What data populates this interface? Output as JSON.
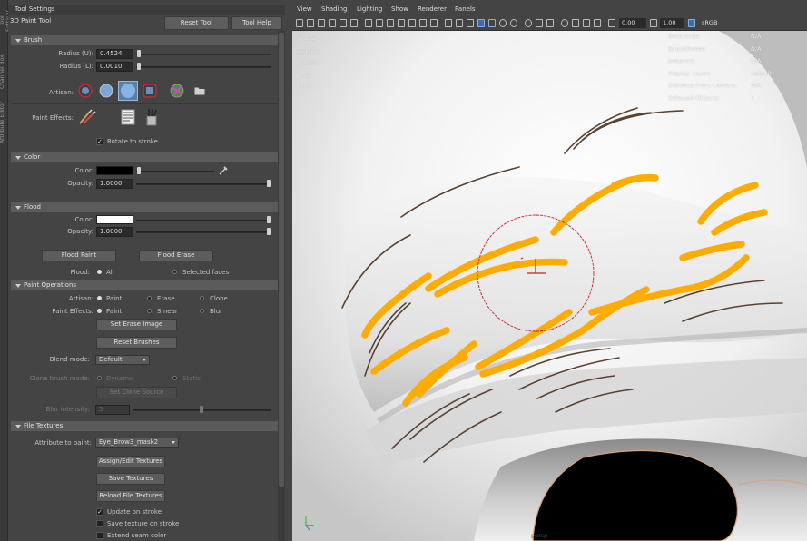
{
  "colors": {
    "panel_bg": "#444444",
    "section_bg": "#5b5b5b",
    "stroke_orange": "#ffac00",
    "brush_circle": "#cc1e28",
    "hair_brown": "#5a4232",
    "viewport_bg": "#e6e6e6"
  },
  "side_tabs": [
    "Tool Settings",
    "Channel Box",
    "Attribute Editor"
  ],
  "panel": {
    "tab_label": "Tool Settings",
    "tool_name": "3D Paint Tool",
    "reset_tool": "Reset Tool",
    "tool_help": "Tool Help"
  },
  "brush": {
    "title": "Brush",
    "radius_u_label": "Radius (U):",
    "radius_u_value": "0.4524",
    "radius_u_level": 0.01,
    "radius_l_label": "Radius (L):",
    "radius_l_value": "0.0010",
    "radius_l_level": 0.01,
    "artisan_label": "Artisan:",
    "artisan_icons": [
      "brush-soft-icon",
      "brush-solid-icon",
      "brush-solid-large-icon",
      "brush-square-icon",
      "brush-texture-icon",
      "folder-icon"
    ],
    "paint_effects_label": "Paint Effects:",
    "paint_effects_icons": [
      "paint-effects-brush-icon",
      "brush-settings-icon",
      "brushes-icon"
    ],
    "rotate_label": "Rotate to stroke",
    "rotate_checked": true
  },
  "color": {
    "title": "Color",
    "color_label": "Color:",
    "color_value": "#000000",
    "color_level": 0.01,
    "opacity_label": "Opacity:",
    "opacity_value": "1.0000",
    "opacity_level": 1.0
  },
  "flood": {
    "title": "Flood",
    "color_label": "Color:",
    "color_value": "#ffffff",
    "color_level": 1.0,
    "opacity_label": "Opacity:",
    "opacity_value": "1.0000",
    "opacity_level": 1.0,
    "flood_paint": "Flood Paint",
    "flood_erase": "Flood Erase",
    "flood_label": "Flood:",
    "option_all": "All",
    "option_selected": "Selected faces",
    "selected": "All"
  },
  "paint_operations": {
    "title": "Paint Operations",
    "artisan_label": "Artisan:",
    "artisan_options": [
      "Paint",
      "Erase",
      "Clone"
    ],
    "artisan_selected": "Paint",
    "effects_label": "Paint Effects:",
    "effects_options": [
      "Paint",
      "Smear",
      "Blur"
    ],
    "effects_selected": "Paint",
    "set_erase_image": "Set Erase Image",
    "reset_brushes": "Reset Brushes",
    "blend_label": "Blend mode:",
    "blend_value": "Default",
    "clone_label": "Clone brush mode:",
    "clone_options": [
      "Dynamic",
      "Static"
    ],
    "clone_selected": "Dynamic",
    "set_clone_source": "Set Clone Source",
    "blur_label": "Blur intensity:",
    "blur_value": "5",
    "blur_level": 0.5
  },
  "file_textures": {
    "title": "File Textures",
    "attribute_label": "Attribute to paint:",
    "attribute_value": "Eye_Brow3_mask2",
    "assign_edit": "Assign/Edit Textures",
    "save_textures": "Save Textures",
    "reload": "Reload File Textures",
    "update_on_stroke": "Update on stroke",
    "update_checked": true,
    "save_on_stroke": "Save texture on stroke",
    "save_checked": false,
    "extend_seam": "Extend seam color",
    "extend_checked": false
  },
  "viewport": {
    "menus": [
      "View",
      "Shading",
      "Lighting",
      "Show",
      "Renderer",
      "Panels"
    ],
    "toolbar_value_1": "0.00",
    "toolbar_value_2": "1.00",
    "color_space": "sRGB gamma",
    "camera_label": "persp",
    "hud_left_labels": [
      "Verts:",
      "Edges:",
      "Faces:",
      "Tris:",
      "UVs:"
    ],
    "hud_left_col1": [
      "",
      "",
      "",
      "",
      ""
    ],
    "hud_left_col2": [
      "",
      "",
      "",
      "",
      ""
    ],
    "hud_left_col3": [
      "",
      "",
      "",
      "",
      ""
    ],
    "hud_right_labels": [
      "Backfaces:",
      "Smoothness:",
      "Instance:",
      "Display Layer:",
      "Distance From Camera:",
      "Selected Objects:"
    ],
    "hud_right_values": [
      "N/A",
      "N/A",
      "N/A",
      "default",
      "N/A",
      "1"
    ]
  }
}
